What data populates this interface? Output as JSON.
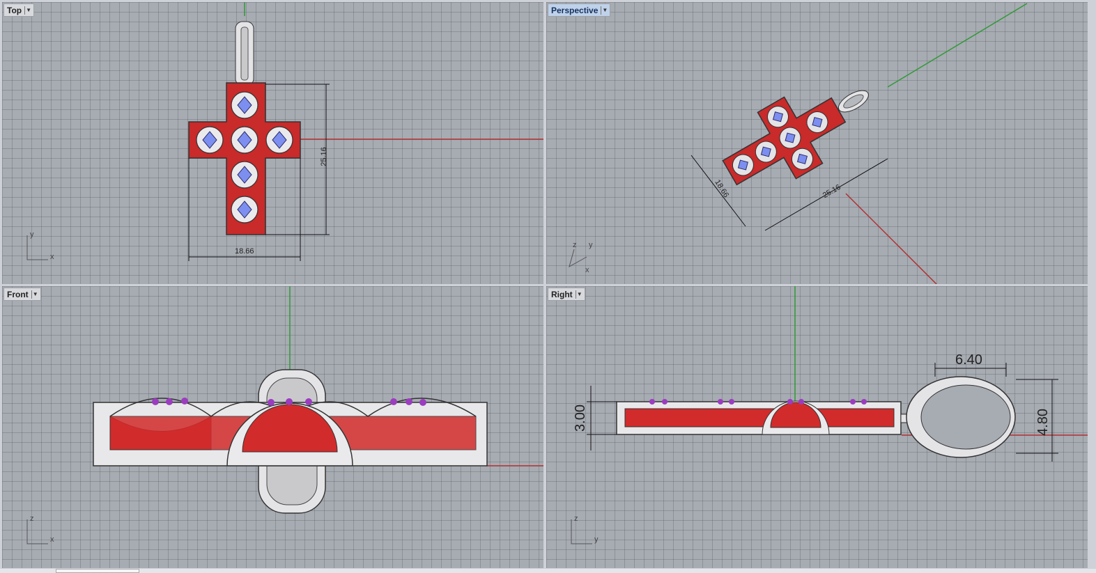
{
  "viewports": {
    "top": {
      "title": "Top"
    },
    "perspective": {
      "title": "Perspective"
    },
    "front": {
      "title": "Front"
    },
    "right": {
      "title": "Right"
    }
  },
  "dimensions": {
    "top_width": "18.66",
    "top_height": "25.16",
    "persp_width": "18.66",
    "persp_height": "25.16",
    "right_thickness": "3.00",
    "right_bail_width": "6.40",
    "right_bail_height": "4.80"
  },
  "axis_labels": {
    "top": {
      "v": "y",
      "h": "x"
    },
    "persp": {
      "a": "z",
      "b": "y",
      "c": "x"
    },
    "front": {
      "v": "z",
      "h": "x"
    },
    "right": {
      "v": "z",
      "h": "y"
    }
  },
  "colors": {
    "viewport_bg": "#a7abb2",
    "x_axis": "#b03030",
    "y_axis": "#2f9a36",
    "metal": "#e4e4e6",
    "enamel": "#d22b2b",
    "stone": "#7c8ff0",
    "amethyst": "#9b3dbf",
    "active_title_bg": "#bfd2ea"
  },
  "icons": {
    "viewport_menu": "chevron-down-icon"
  }
}
